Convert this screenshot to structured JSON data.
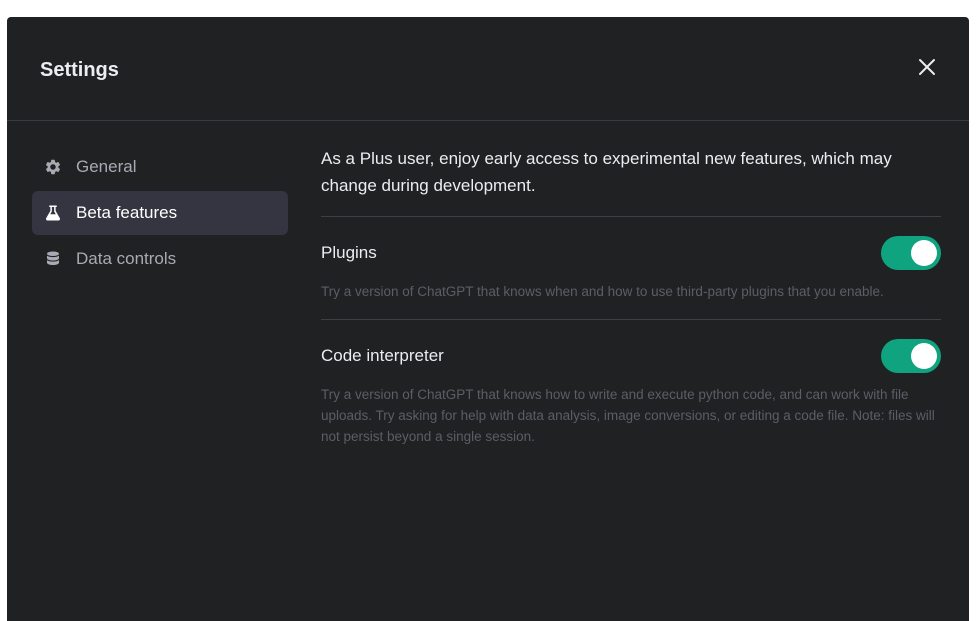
{
  "header": {
    "title": "Settings",
    "close_icon": "close-icon"
  },
  "sidebar": {
    "items": [
      {
        "label": "General",
        "icon": "gear-icon",
        "active": false
      },
      {
        "label": "Beta features",
        "icon": "flask-icon",
        "active": true
      },
      {
        "label": "Data controls",
        "icon": "database-icon",
        "active": false
      }
    ]
  },
  "main": {
    "intro": "As a Plus user, enjoy early access to experimental new features, which may change during development.",
    "features": [
      {
        "name": "Plugins",
        "enabled": true,
        "description": "Try a version of ChatGPT that knows when and how to use third-party plugins that you enable."
      },
      {
        "name": "Code interpreter",
        "enabled": true,
        "description": "Try a version of ChatGPT that knows how to write and execute python code, and can work with file uploads. Try asking for help with data analysis, image conversions, or editing a code file. Note: files will not persist beyond a single session."
      }
    ]
  },
  "colors": {
    "modal_bg": "#202123",
    "active_nav_bg": "#343541",
    "toggle_on": "#10a37f",
    "text_primary": "#ececf1",
    "text_muted": "#5c5d67"
  }
}
